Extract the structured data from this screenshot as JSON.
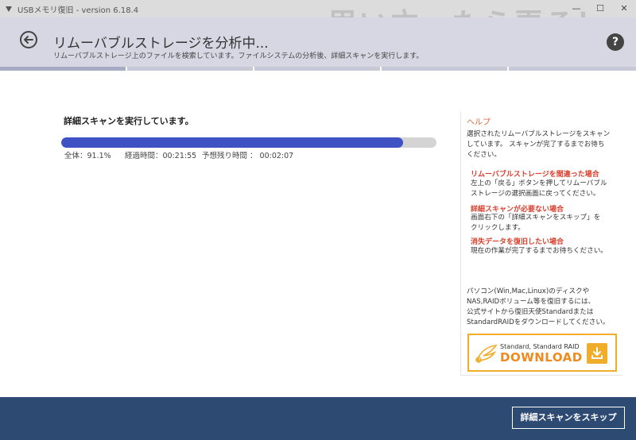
{
  "window": {
    "title": "USBメモリ復旧 - version 6.18.4",
    "minimize": "—",
    "maximize": "☐",
    "close": "✕",
    "watermark": "思い立ったら弄る！"
  },
  "header": {
    "title": "リムーバブルストレージを分析中...",
    "subtitle": "リムーバブルストレージ上のファイルを検索しています。ファイルシステムの分析後、詳細スキャンを実行します。",
    "help_label": "?"
  },
  "main": {
    "status": "詳細スキャンを実行しています。",
    "progress_fraction": 0.911,
    "total": "全体：91.1%",
    "elapsed": "経過時間：00:21:55",
    "remaining": "予想残り時間 ： 00:02:07"
  },
  "help": {
    "heading": "ヘルプ",
    "intro": [
      "選択されたリムーバブルストレージをスキャン",
      "しています。 スキャンが完了するまでお待ち",
      "ください。"
    ],
    "sections": [
      {
        "title": "リムーバブルストレージを間違った場合",
        "lines": [
          "左上の「戻る」ボタンを押してリムーバブル",
          "ストレージの選択画面に戻ってください。"
        ]
      },
      {
        "title": "詳細スキャンが必要ない場合",
        "lines": [
          "画面右下の「詳細スキャンをスキップ」を",
          "クリックします。"
        ]
      },
      {
        "title": "消失データを復旧したい場合",
        "lines": [
          "現在の作業が完了するまでお待ちください。"
        ]
      }
    ],
    "promo": [
      "パソコン(Win,Mac,Linux)のディスクや",
      "NAS,RAIDボリューム等を復旧するには、",
      "公式サイトから復旧天使Standardまたは",
      "StandardRAIDをダウンロードしてください。"
    ],
    "download_small": "Standard, Standard RAID",
    "download_big": "DOWNLOAD"
  },
  "footer": {
    "skip_label": "詳細スキャンをスキップ"
  },
  "colors": {
    "accent": "#3f52c4",
    "footer": "#2d4a73",
    "help_heading": "#e06a3a",
    "help_red": "#d9412f",
    "download": "#f0ad2a"
  }
}
